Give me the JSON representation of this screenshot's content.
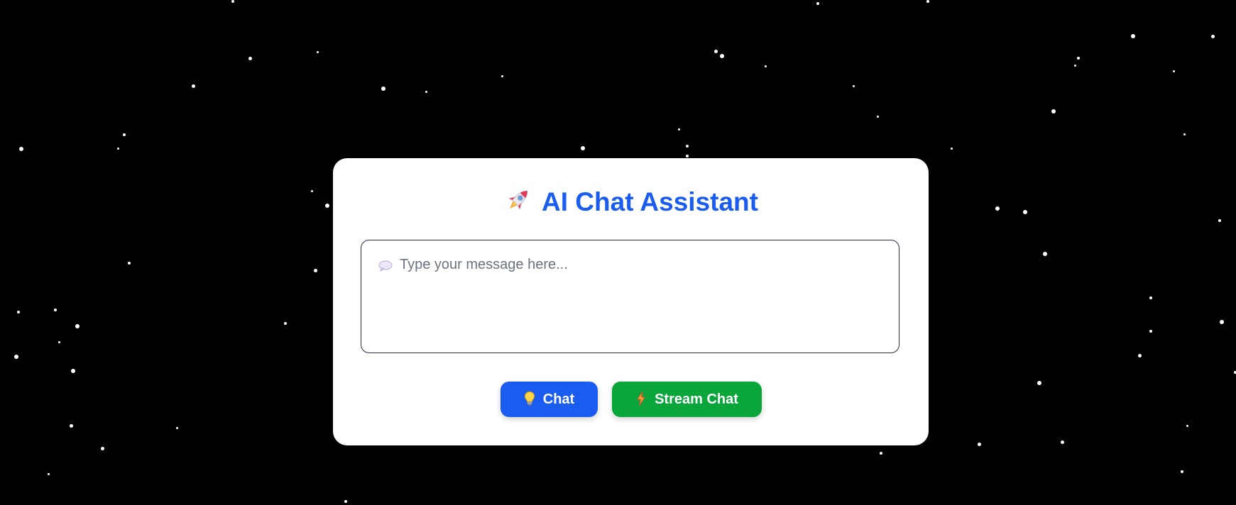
{
  "app": {
    "title": "AI Chat Assistant",
    "title_icon": "rocket-icon"
  },
  "input": {
    "placeholder": "Type your message here...",
    "value": "",
    "icon": "speech-bubble-icon"
  },
  "buttons": {
    "chat_label": "Chat",
    "chat_icon": "lightbulb-icon",
    "stream_label": "Stream Chat",
    "stream_icon": "lightning-icon"
  },
  "colors": {
    "background": "#000000",
    "accent": "#1a5cf0",
    "stream": "#0aa63c",
    "card": "#ffffff"
  }
}
